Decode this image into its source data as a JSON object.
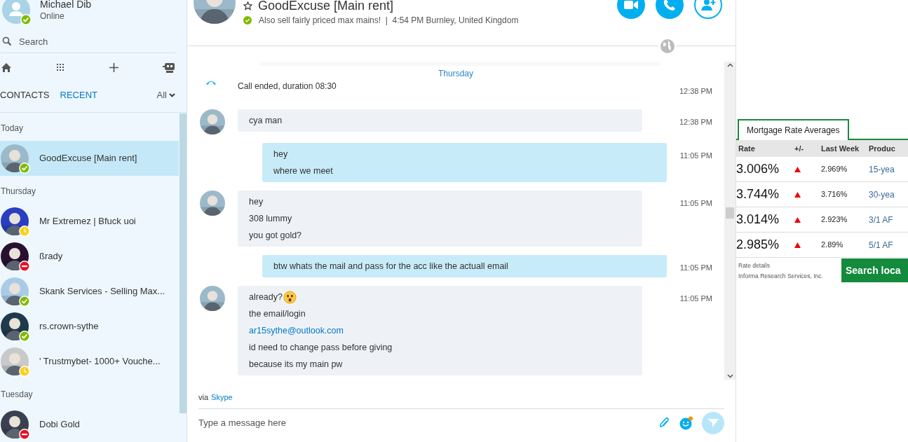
{
  "profile": {
    "name": "Michael Dib",
    "status_text": "Online",
    "color": "#7fba00",
    "kind": "online"
  },
  "search": {
    "placeholder": "Search"
  },
  "tabs": [
    {
      "label": "CONTACTS",
      "selected": false
    },
    {
      "label": "RECENT",
      "selected": true
    }
  ],
  "filter": {
    "label": "All"
  },
  "recent": [
    {
      "group": "Today",
      "contacts": [
        {
          "name": "GoodExcuse [Main rent]",
          "color": "#7fba00",
          "kind": "online",
          "selected": true
        }
      ]
    },
    {
      "group": "Thursday",
      "contacts": [
        {
          "name": "Mr Extremez | Bfuck uoi",
          "color": "#fcd116",
          "kind": "away",
          "selected": false
        },
        {
          "name": "ßrady",
          "color": "#e81123",
          "kind": "busy",
          "selected": false
        },
        {
          "name": "Skank Services - Selling Max...",
          "color": "#7fba00",
          "kind": "online",
          "selected": false
        },
        {
          "name": "rs.crown-sythe",
          "color": "#7fba00",
          "kind": "online",
          "selected": false
        },
        {
          "name": "' Trustmybet- 1000+ Vouche...",
          "color": "#fcd116",
          "kind": "away",
          "selected": false
        }
      ]
    },
    {
      "group": "Tuesday",
      "contacts": [
        {
          "name": "Dobi Gold",
          "color": "#e81123",
          "kind": "busy",
          "selected": false
        }
      ]
    }
  ],
  "chat_header": {
    "name": "GoodExcuse [Main rent]",
    "color": "#7fba00",
    "kind": "online",
    "mood": "Also sell fairly priced max mains!  |  4:54 PM Burnley, United Kingdom"
  },
  "day_label": "Thursday",
  "messages": [
    {
      "kind": "call",
      "text": "Call ended, duration 08:30",
      "time": "12:38 PM"
    },
    {
      "kind": "incoming",
      "lines": [
        "cya man"
      ],
      "time": "12:38 PM"
    },
    {
      "kind": "outgoing",
      "lines": [
        "hey",
        "where we meet"
      ],
      "time": "11:05 PM"
    },
    {
      "kind": "incoming",
      "lines": [
        "hey",
        "308 lummy",
        "you got gold?"
      ],
      "time": "11:05 PM"
    },
    {
      "kind": "outgoing",
      "lines": [
        "btw whats the mail and pass for the acc like the actuall email"
      ],
      "time": "11:05 PM"
    },
    {
      "kind": "incoming",
      "lines": [
        {
          "kind": "emoji",
          "text": "already?"
        },
        {
          "kind": "text",
          "text": "the email/login"
        },
        {
          "kind": "link",
          "text": "ar15sythe@outlook.com"
        },
        {
          "kind": "text",
          "text": "id need to change pass before giving"
        },
        {
          "kind": "text",
          "text": "because its my main pw"
        }
      ],
      "time": "11:05 PM"
    }
  ],
  "via": {
    "prefix": "via",
    "service": "Skype"
  },
  "composer": {
    "placeholder": "Type a message here"
  },
  "ad": {
    "tab": "Mortgage Rate Averages",
    "columns": [
      "Rate",
      "+/-",
      "Last Week",
      "Produc"
    ],
    "rows": [
      {
        "rate": "3.006%",
        "rising": true,
        "last_week": "2.969%",
        "product": "15-yea"
      },
      {
        "rate": "3.744%",
        "rising": true,
        "last_week": "3.716%",
        "product": "30-yea"
      },
      {
        "rate": "3.014%",
        "rising": true,
        "last_week": "2.923%",
        "product": "3/1 AF"
      },
      {
        "rate": "2.985%",
        "rising": true,
        "last_week": "2.89%",
        "product": "5/1 AF"
      }
    ],
    "footer": [
      "Rate details",
      "Informa Research Services, Inc."
    ],
    "button": "Search loca"
  }
}
